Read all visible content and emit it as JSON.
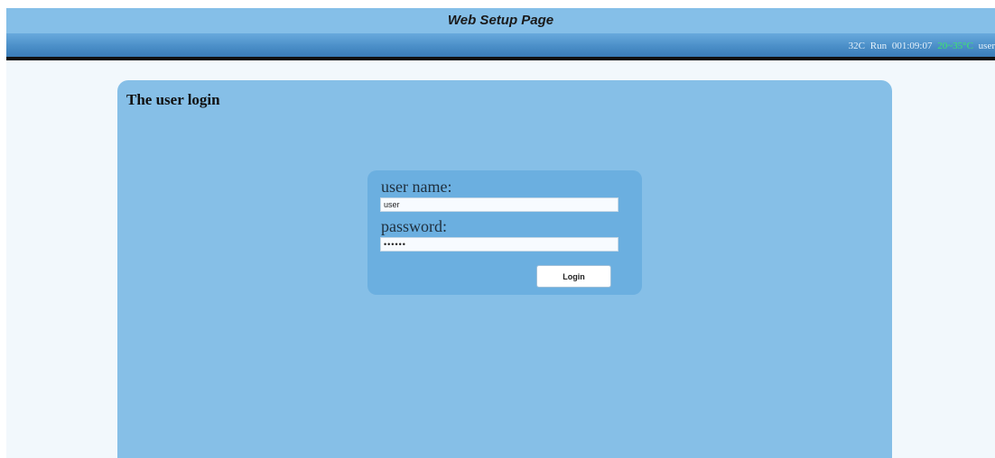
{
  "header": {
    "title": "Web Setup Page"
  },
  "status": {
    "temperature": "32C",
    "run_label": "Run",
    "run_time": "001:09:07",
    "temp_range": "20~35°C",
    "user": "user"
  },
  "panel": {
    "heading": "The user login"
  },
  "login": {
    "username_label": "user name:",
    "username_value": "user",
    "password_label": "password:",
    "password_value": "••••••",
    "button_label": "Login"
  },
  "colors": {
    "title_bar": "#85bfe8",
    "status_bar": "#4b8fc8",
    "panel": "#86bfe7",
    "login_box": "#6bafe0",
    "temp_range": "#3ee86b"
  }
}
